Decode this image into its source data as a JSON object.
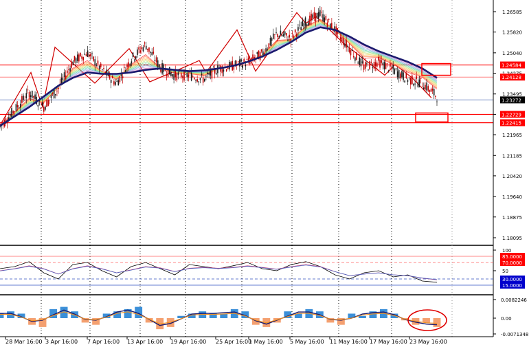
{
  "chart_data": [
    {
      "type": "line",
      "title": "",
      "price_axis_ticks": [
        "1.26585",
        "1.25820",
        "1.25040",
        "1.24275",
        "1.23495",
        "1.22730",
        "1.21965",
        "1.21185",
        "1.20420",
        "1.19640",
        "1.18875",
        "1.18095"
      ],
      "tagged_levels": [
        {
          "value": "1.24584",
          "bg": "#ff0000",
          "fg": "#ffffff"
        },
        {
          "value": "1.24128",
          "bg": "#ff0000",
          "fg": "#ffffff"
        },
        {
          "value": "1.23272",
          "bg": "#000000",
          "fg": "#ffffff"
        },
        {
          "value": "1.22729",
          "bg": "#ff0000",
          "fg": "#ffffff"
        },
        {
          "value": "1.22415",
          "bg": "#ff0000",
          "fg": "#ffffff"
        }
      ],
      "x_labels": [
        "28 Mar 16:00",
        "3 Apr 16:00",
        "7 Apr 16:00",
        "13 Apr 16:00",
        "19 Apr 16:00",
        "25 Apr 16:00",
        "1 May 16:00",
        "5 May 16:00",
        "11 May 16:00",
        "17 May 16:00",
        "23 May 16:00"
      ],
      "series": [
        {
          "values": [
            1.2225,
            1.229,
            1.2355,
            1.23,
            1.237,
            1.247,
            1.2505,
            1.244,
            1.239,
            1.248,
            1.2535,
            1.245,
            1.242,
            1.242,
            1.2405,
            1.2445,
            1.2455,
            1.247,
            1.25,
            1.2575,
            1.256,
            1.262,
            1.265,
            1.259,
            1.252,
            1.245,
            1.247,
            1.244,
            1.2405,
            1.239,
            1.234
          ]
        },
        {
          "values": [
            1.223,
            1.2265,
            1.23,
            1.234,
            1.238,
            1.241,
            1.243,
            1.2425,
            1.2425,
            1.243,
            1.244,
            1.2445,
            1.244,
            1.2435,
            1.2438,
            1.2445,
            1.2455,
            1.247,
            1.249,
            1.2515,
            1.2545,
            1.258,
            1.26,
            1.259,
            1.2565,
            1.2535,
            1.251,
            1.249,
            1.247,
            1.2445,
            1.241
          ]
        }
      ]
    },
    {
      "type": "line",
      "title": "",
      "ticks": [
        "100",
        "50"
      ],
      "tagged_levels": [
        {
          "value": "85.0000",
          "bg": "#ff0000",
          "fg": "#ffffff"
        },
        {
          "value": "70.0000",
          "bg": "#ff0000",
          "fg": "#ffffff"
        },
        {
          "value": "30.0000",
          "bg": "#0000cc",
          "fg": "#ffffff"
        },
        {
          "value": "15.0000",
          "bg": "#0000cc",
          "fg": "#ffffff"
        }
      ],
      "ylim": [
        0,
        100
      ],
      "series": [
        {
          "values": [
            55,
            60,
            72,
            45,
            30,
            65,
            70,
            50,
            35,
            60,
            70,
            55,
            40,
            65,
            60,
            55,
            62,
            70,
            55,
            50,
            65,
            72,
            60,
            40,
            30,
            45,
            50,
            35,
            40,
            25,
            22
          ]
        },
        {
          "values": [
            50,
            55,
            62,
            55,
            42,
            55,
            62,
            55,
            45,
            52,
            60,
            57,
            48,
            56,
            58,
            56,
            58,
            62,
            58,
            54,
            60,
            65,
            60,
            48,
            38,
            42,
            45,
            40,
            38,
            32,
            28
          ]
        }
      ]
    },
    {
      "type": "bar",
      "title": "",
      "ticks": [
        "0.0082246",
        "0.00",
        "-0.0071348"
      ],
      "values": [
        0.002,
        0.003,
        0.002,
        -0.003,
        -0.004,
        0.004,
        0.005,
        0.003,
        -0.002,
        -0.003,
        0.002,
        0.003,
        0.004,
        0.005,
        -0.002,
        -0.005,
        -0.004,
        0.001,
        0.002,
        0.003,
        0.002,
        0.002,
        0.004,
        0.003,
        -0.003,
        -0.004,
        -0.002,
        0.003,
        0.002,
        0.004,
        0.003,
        -0.002,
        -0.003,
        0.002,
        0.001,
        0.003,
        0.004,
        0.002,
        -0.001,
        -0.003,
        -0.002,
        -0.004
      ]
    }
  ]
}
